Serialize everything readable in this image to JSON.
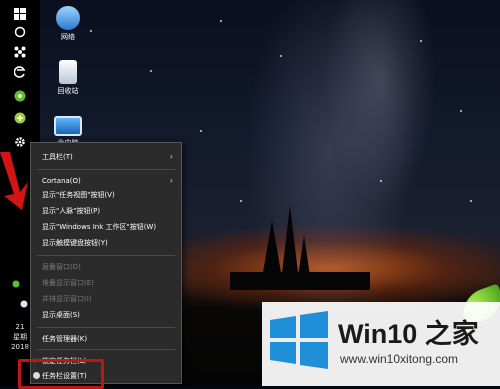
{
  "desktop": {
    "icons": [
      {
        "label": "网络",
        "icon": "network-icon"
      },
      {
        "label": "回收站",
        "icon": "recycle-bin-icon"
      },
      {
        "label": "此电脑",
        "icon": "this-pc-icon"
      }
    ]
  },
  "taskbar": {
    "icons": [
      "start-icon",
      "cortana-icon",
      "task-view-icon",
      "edge-icon",
      "app-green-icon",
      "app-yellow-green-icon",
      "settings-gear-icon"
    ],
    "tray_time_line1": "21",
    "tray_time_line2": "星期",
    "tray_time_line3": "2018"
  },
  "context_menu": {
    "items": [
      {
        "label": "工具栏(T)",
        "submenu": true,
        "enabled": true
      },
      {
        "label": "Cortana(O)",
        "submenu": true,
        "enabled": true
      },
      {
        "label": "显示\"任务视图\"按钮(V)",
        "enabled": true,
        "checked": false
      },
      {
        "label": "显示\"人脉\"按钮(P)",
        "enabled": true
      },
      {
        "label": "显示\"Windows Ink 工作区\"按钮(W)",
        "enabled": true
      },
      {
        "label": "显示触摸键盘按钮(Y)",
        "enabled": true
      },
      {
        "label": "层叠窗口(D)",
        "enabled": false
      },
      {
        "label": "堆叠显示窗口(E)",
        "enabled": false
      },
      {
        "label": "并排显示窗口(I)",
        "enabled": false
      },
      {
        "label": "显示桌面(S)",
        "enabled": true
      },
      {
        "label": "任务管理器(K)",
        "enabled": true
      },
      {
        "label": "锁定任务栏(L)",
        "enabled": true,
        "checked": true
      },
      {
        "label": "任务栏设置(T)",
        "enabled": true,
        "icon": "gear-icon"
      }
    ],
    "submenu_arrow": "›",
    "check_mark": "✓"
  },
  "watermark": {
    "brand": "Win10 之家",
    "url": "www.win10xitong.com"
  },
  "colors": {
    "menu_bg": "#2b2b2b",
    "highlight_red": "#c01515",
    "win_blue": "#1e8fd8"
  }
}
